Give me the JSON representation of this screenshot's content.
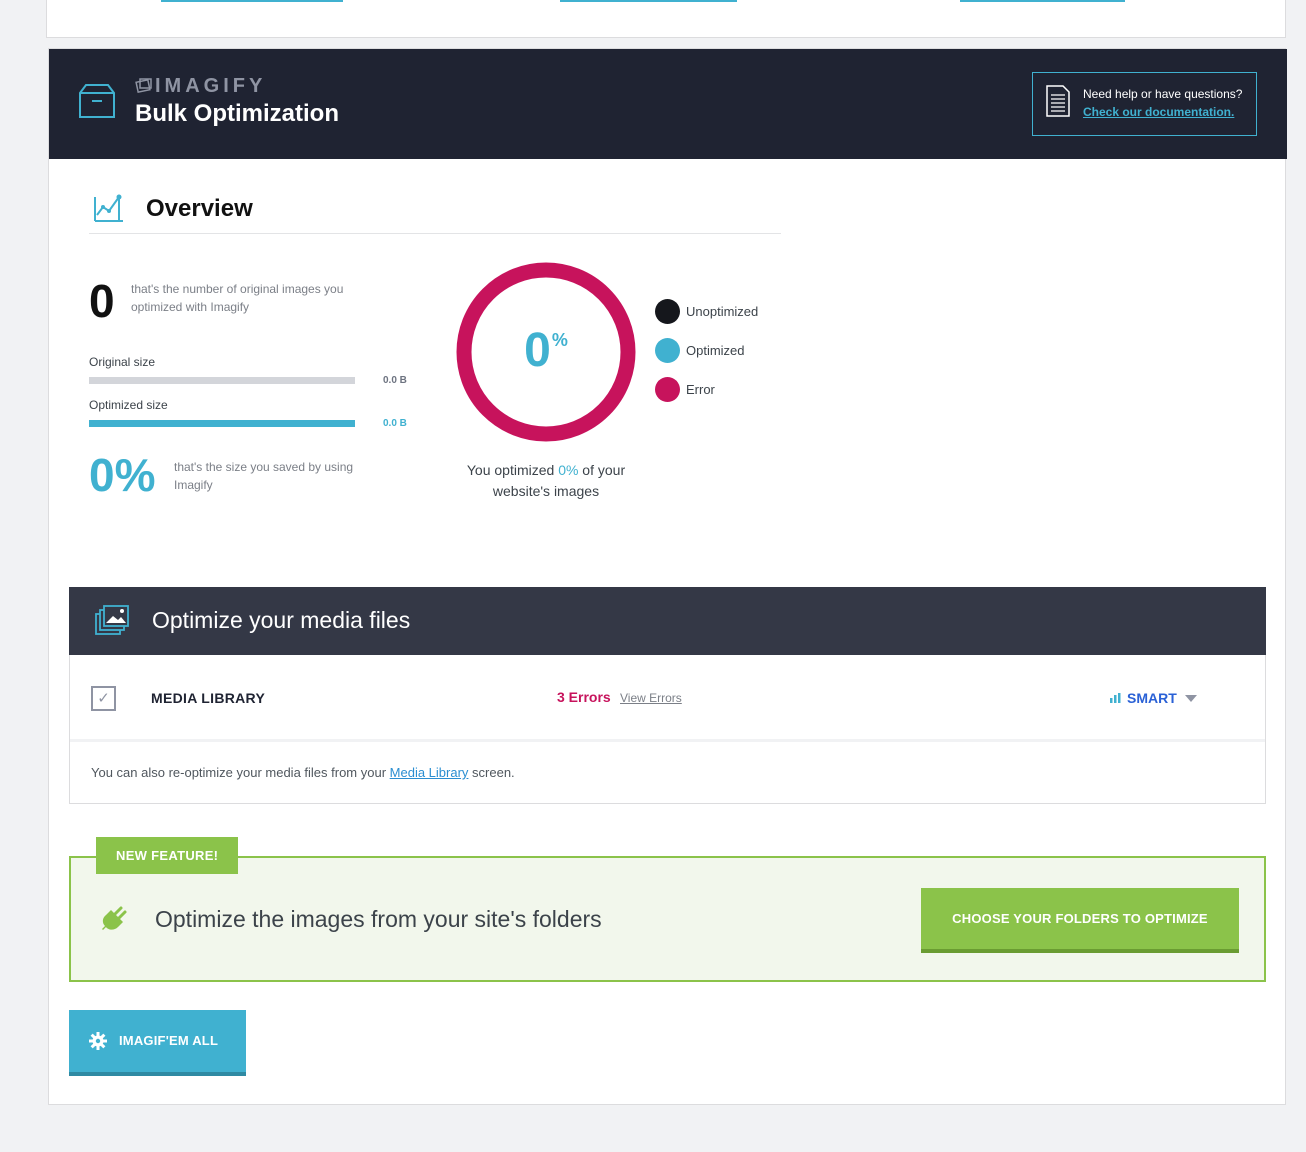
{
  "header": {
    "brand": "IMAGIFY",
    "title": "Bulk Optimization",
    "help_question": "Need help or have questions?",
    "help_link": "Check our documentation."
  },
  "overview": {
    "title": "Overview",
    "optimized_count": "0",
    "optimized_count_desc": "that's the number of original images you optimized with Imagify",
    "original_size_label": "Original size",
    "original_size_value": "0.0 B",
    "optimized_size_label": "Optimized size",
    "optimized_size_value": "0.0 B",
    "saved_pct": "0%",
    "saved_desc": "that's the size you saved by using Imagify",
    "donut_value": "0",
    "donut_unit": "%",
    "caption_before": "You optimized ",
    "caption_pct": "0%",
    "caption_after": " of your website's images",
    "legend": [
      {
        "label": "Unoptimized",
        "color": "#15171c"
      },
      {
        "label": "Optimized",
        "color": "#40b1d0"
      },
      {
        "label": "Error",
        "color": "#c7135c"
      }
    ],
    "donut_error_fraction": 1.0
  },
  "media": {
    "title": "Optimize your media files",
    "library_label": "MEDIA LIBRARY",
    "errors": "3 Errors",
    "view_errors": "View Errors",
    "level": "SMART",
    "note_before": "You can also re-optimize your media files from your ",
    "note_link": "Media Library",
    "note_after": " screen."
  },
  "feature": {
    "badge": "NEW FEATURE!",
    "title": "Optimize the images from your site's folders",
    "button": "CHOOSE YOUR FOLDERS TO OPTIMIZE"
  },
  "actions": {
    "bulk_button": "IMAGIF'EM ALL"
  },
  "colors": {
    "header_bg": "#1f2332",
    "accent_blue": "#40b1d0",
    "error_magenta": "#c7135c",
    "green": "#8bc34a"
  }
}
